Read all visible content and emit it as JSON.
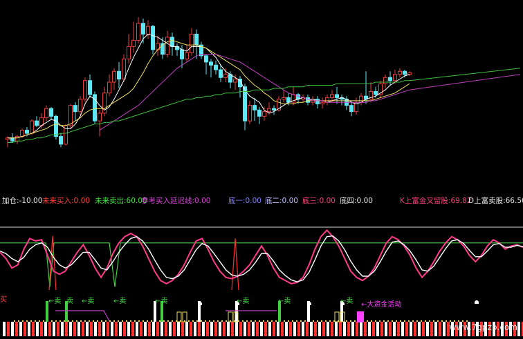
{
  "colors": {
    "background": "#000000",
    "up_candle": "#e84040",
    "down_candle": "#5ee8f5",
    "ma_short": "#ffffff",
    "ma_mid": "#f0e060",
    "ma_long": "#c040c0",
    "ma_longest": "#40c040",
    "k_line": "#ff3a8a",
    "d_line": "#ffffff",
    "level_line": "#40d040",
    "ref_line": "#d8d8d8",
    "big_money": "#ff40ff"
  },
  "indicator_bar": {
    "items": [
      {
        "label": "加仓:",
        "value": "-10.00",
        "color": "#e8e8e8"
      },
      {
        "label": "未来买入:",
        "value": "0.00",
        "color": "#ff4040"
      },
      {
        "label": "未来卖出:",
        "value": "60.00",
        "color": "#40e040"
      },
      {
        "label": "参考买入延迟线:",
        "value": "0.00",
        "color": "#e040e0"
      },
      {
        "label": "底一:",
        "value": "0.00",
        "color": "#8080ff"
      },
      {
        "label": "底二:",
        "value": "0.00",
        "color": "#c0c0ff"
      },
      {
        "label": "底三:",
        "value": "0.00",
        "color": "#ff4080"
      },
      {
        "label": "底四:",
        "value": "0.00",
        "color": "#e8e8e8"
      },
      {
        "label": "K上富金叉留股:",
        "value": "69.82",
        "color": "#ff4080"
      },
      {
        "label": "D上富卖股:",
        "value": "66.50",
        "color": "#e8e8e8"
      }
    ]
  },
  "signals": {
    "buy_label": "买",
    "sell_label": "←卖",
    "sell_plain": "卖",
    "big_money_label": "←大资金活动"
  },
  "watermark": "www.7gpzb.com",
  "chart_data": [
    {
      "type": "candlestick",
      "title": "",
      "candles": [
        [
          18,
          19,
          13,
          20
        ],
        [
          19,
          17,
          16,
          22
        ],
        [
          17,
          20,
          15,
          21
        ],
        [
          20,
          24,
          19,
          25
        ],
        [
          24,
          22,
          20,
          26
        ],
        [
          22,
          30,
          21,
          31
        ],
        [
          30,
          27,
          26,
          33
        ],
        [
          27,
          32,
          25,
          35
        ],
        [
          32,
          38,
          30,
          40
        ],
        [
          38,
          33,
          31,
          39
        ],
        [
          33,
          20,
          18,
          34
        ],
        [
          20,
          15,
          13,
          22
        ],
        [
          15,
          27,
          14,
          28
        ],
        [
          27,
          40,
          25,
          41
        ],
        [
          40,
          36,
          30,
          42
        ],
        [
          36,
          44,
          34,
          46
        ],
        [
          44,
          56,
          42,
          58
        ],
        [
          56,
          47,
          45,
          60
        ],
        [
          47,
          30,
          28,
          49
        ],
        [
          30,
          35,
          20,
          37
        ],
        [
          35,
          48,
          33,
          52
        ],
        [
          48,
          55,
          46,
          60
        ],
        [
          55,
          62,
          50,
          64
        ],
        [
          62,
          57,
          51,
          68
        ],
        [
          57,
          70,
          55,
          73
        ],
        [
          70,
          78,
          67,
          86
        ],
        [
          78,
          82,
          74,
          94
        ],
        [
          82,
          93,
          80,
          97
        ],
        [
          93,
          86,
          80,
          96
        ],
        [
          86,
          91,
          83,
          95
        ],
        [
          91,
          76,
          73,
          92
        ],
        [
          76,
          80,
          72,
          85
        ],
        [
          80,
          73,
          70,
          84
        ],
        [
          73,
          84,
          71,
          88
        ],
        [
          84,
          78,
          72,
          87
        ],
        [
          78,
          76,
          72,
          80
        ],
        [
          76,
          70,
          64,
          79
        ],
        [
          70,
          74,
          68,
          79
        ],
        [
          74,
          86,
          72,
          90
        ],
        [
          86,
          79,
          70,
          89
        ],
        [
          79,
          72,
          70,
          81
        ],
        [
          72,
          68,
          60,
          73
        ],
        [
          68,
          66,
          58,
          70
        ],
        [
          66,
          63,
          60,
          69
        ],
        [
          63,
          58,
          55,
          66
        ],
        [
          58,
          60,
          55,
          64
        ],
        [
          60,
          55,
          51,
          62
        ],
        [
          55,
          57,
          50,
          60
        ],
        [
          57,
          52,
          45,
          59
        ],
        [
          52,
          30,
          24,
          54
        ],
        [
          30,
          40,
          28,
          43
        ],
        [
          40,
          37,
          30,
          45
        ],
        [
          37,
          33,
          28,
          39
        ],
        [
          33,
          36,
          30,
          39
        ],
        [
          36,
          38,
          34,
          42
        ],
        [
          38,
          37,
          34,
          40
        ],
        [
          37,
          44,
          36,
          46
        ],
        [
          44,
          45,
          42,
          50
        ],
        [
          45,
          42,
          40,
          48
        ],
        [
          42,
          47,
          40,
          52
        ],
        [
          47,
          44,
          41,
          48
        ],
        [
          44,
          45,
          42,
          47
        ],
        [
          45,
          42,
          40,
          47
        ],
        [
          42,
          44,
          40,
          46
        ],
        [
          44,
          41,
          38,
          46
        ],
        [
          41,
          42,
          38,
          45
        ],
        [
          42,
          45,
          40,
          47
        ],
        [
          45,
          47,
          42,
          50
        ],
        [
          47,
          45,
          41,
          52
        ],
        [
          45,
          44,
          40,
          47
        ],
        [
          44,
          40,
          37,
          46
        ],
        [
          40,
          36,
          33,
          43
        ],
        [
          36,
          42,
          34,
          45
        ],
        [
          42,
          46,
          40,
          48
        ],
        [
          46,
          44,
          41,
          62
        ],
        [
          44,
          49,
          42,
          55
        ],
        [
          49,
          47,
          45,
          52
        ],
        [
          47,
          54,
          45,
          56
        ],
        [
          54,
          58,
          51,
          60
        ],
        [
          58,
          56,
          53,
          62
        ],
        [
          56,
          60,
          54,
          63
        ],
        [
          60,
          62,
          58,
          64
        ],
        [
          62,
          60,
          58,
          63
        ],
        [
          60,
          61,
          59,
          62
        ]
      ],
      "ma": [
        {
          "name": "MA5",
          "color": "#ffffff",
          "values": [
            19,
            19,
            19,
            20,
            21,
            22,
            24,
            27,
            29,
            31,
            30,
            27,
            25,
            25,
            28,
            33,
            41,
            46,
            44,
            40,
            37,
            39,
            44,
            50,
            56,
            64,
            71,
            77,
            83,
            86,
            85,
            84,
            82,
            80,
            78,
            78,
            76,
            75,
            78,
            78,
            78,
            77,
            74,
            71,
            66,
            62,
            60,
            58,
            56,
            50,
            46,
            44,
            42,
            37,
            35,
            36,
            38,
            40,
            42,
            43,
            44,
            45,
            44,
            44,
            43,
            43,
            42,
            43,
            44,
            45,
            44,
            42,
            41,
            42,
            44,
            45,
            46,
            48,
            50,
            53,
            55,
            57,
            59,
            60
          ]
        },
        {
          "name": "MA10",
          "color": "#f0e060",
          "values": [
            19,
            19,
            19,
            20,
            21,
            22,
            23,
            24,
            25,
            27,
            28,
            27,
            27,
            28,
            30,
            32,
            35,
            37,
            38,
            38,
            38,
            40,
            42,
            44,
            46,
            48,
            51,
            56,
            61,
            67,
            72,
            76,
            79,
            81,
            82,
            81,
            80,
            79,
            79,
            79,
            78,
            77,
            75,
            73,
            71,
            69,
            67,
            65,
            63,
            59,
            56,
            53,
            51,
            48,
            46,
            43,
            42,
            41,
            41,
            41,
            42,
            42,
            43,
            43,
            43,
            43,
            43,
            43,
            43,
            43,
            43,
            43,
            43,
            43,
            43,
            43,
            44,
            45,
            46,
            47,
            48,
            50,
            52,
            54
          ]
        },
        {
          "name": "MA20",
          "color": "#c040c0",
          "values": [
            null,
            null,
            null,
            null,
            null,
            null,
            null,
            null,
            null,
            null,
            null,
            null,
            null,
            null,
            null,
            null,
            null,
            null,
            null,
            24,
            26,
            28,
            30,
            32,
            34,
            36,
            38,
            40,
            43,
            46,
            49,
            52,
            55,
            58,
            61,
            64,
            66,
            68,
            70,
            72,
            73,
            73,
            73,
            73,
            72,
            71,
            70,
            69,
            68,
            66,
            64,
            62,
            60,
            58,
            56,
            54,
            52,
            50,
            48,
            47,
            46,
            45,
            44,
            43,
            43,
            43,
            42,
            42,
            42,
            42,
            42,
            42,
            42,
            42,
            42,
            43,
            43,
            44,
            45,
            46,
            47,
            48,
            49,
            50
          ]
        },
        {
          "name": "MA60",
          "color": "#40c040",
          "values": [
            16,
            16,
            17,
            17,
            18,
            18,
            19,
            19,
            20,
            21,
            21,
            22,
            22,
            23,
            24,
            25,
            26,
            27,
            28,
            28,
            29,
            29,
            30,
            30,
            31,
            32,
            33,
            34,
            35,
            36,
            37,
            38,
            39,
            40,
            41,
            42,
            43,
            44,
            44,
            45,
            45,
            46,
            46,
            47,
            47,
            48,
            48,
            48,
            49,
            49,
            49,
            50,
            50,
            50,
            50,
            51,
            51,
            51,
            52,
            52,
            52,
            52,
            53,
            53,
            53,
            53,
            53,
            53,
            54,
            54,
            54,
            54,
            54,
            54,
            54,
            54,
            55,
            55,
            55,
            55,
            55,
            55,
            56,
            56
          ]
        }
      ]
    },
    {
      "type": "line",
      "title": "",
      "ylim": [
        0,
        100
      ],
      "levels": [
        {
          "name": "ref",
          "value": 100,
          "color": "#d8d8d8"
        },
        {
          "name": "green",
          "value": 75,
          "color": "#40d040"
        }
      ],
      "series": [
        {
          "name": "K",
          "color": "#ff3a8a",
          "values": [
            60,
            50,
            35,
            40,
            65,
            82,
            78,
            80,
            55,
            30,
            25,
            30,
            45,
            60,
            72,
            55,
            35,
            20,
            35,
            58,
            75,
            85,
            90,
            85,
            70,
            50,
            30,
            15,
            10,
            15,
            25,
            40,
            60,
            78,
            82,
            65,
            45,
            30,
            20,
            18,
            22,
            30,
            40,
            55,
            70,
            55,
            35,
            20,
            15,
            10,
            12,
            20,
            40,
            65,
            85,
            95,
            85,
            70,
            50,
            30,
            20,
            15,
            22,
            35,
            55,
            75,
            85,
            80,
            70,
            55,
            35,
            20,
            30,
            45,
            62,
            75,
            85,
            80,
            70,
            55,
            45,
            55,
            70,
            80,
            75,
            65,
            70,
            72,
            68
          ]
        },
        {
          "name": "D",
          "color": "#ffffff",
          "values": [
            62,
            58,
            50,
            45,
            52,
            65,
            72,
            75,
            68,
            52,
            40,
            35,
            40,
            50,
            60,
            60,
            48,
            35,
            32,
            45,
            60,
            72,
            82,
            85,
            78,
            65,
            48,
            32,
            20,
            18,
            22,
            32,
            48,
            64,
            74,
            70,
            58,
            45,
            32,
            24,
            22,
            25,
            32,
            44,
            58,
            58,
            46,
            32,
            23,
            16,
            13,
            16,
            28,
            48,
            70,
            85,
            86,
            78,
            64,
            46,
            32,
            22,
            22,
            30,
            45,
            62,
            76,
            78,
            72,
            62,
            48,
            32,
            30,
            38,
            52,
            66,
            78,
            80,
            74,
            63,
            53,
            53,
            62,
            72,
            74,
            68,
            68,
            71,
            69
          ]
        }
      ]
    }
  ]
}
